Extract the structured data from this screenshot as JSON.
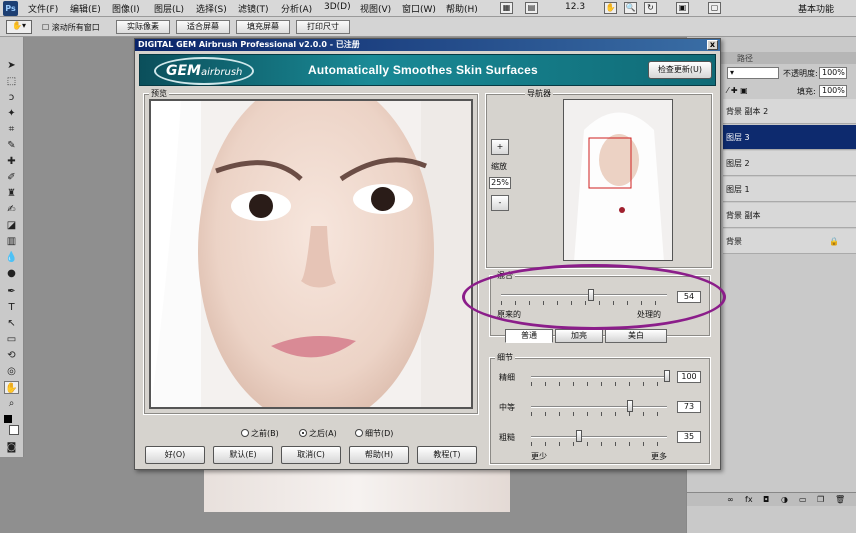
{
  "menubar": {
    "app_icon": "Ps",
    "items": [
      "文件(F)",
      "编辑(E)",
      "图像(I)",
      "图层(L)",
      "选择(S)",
      "滤镜(T)",
      "分析(A)",
      "3D(D)",
      "视图(V)",
      "窗口(W)",
      "帮助(H)"
    ],
    "zoom": "12.3",
    "workspace": "基本功能"
  },
  "optionsbar": {
    "checkbox_label": "滚动所有窗口",
    "buttons": [
      "实际像素",
      "适合屏幕",
      "填充屏幕",
      "打印尺寸"
    ]
  },
  "layers_panel": {
    "opacity_label": "不透明度:",
    "opacity_value": "100%",
    "fill_label": "填充:",
    "fill_value": "100%",
    "layers": [
      "背景 副本 2",
      "图层 3",
      "图层 2",
      "图层 1",
      "背景 副本",
      "背景"
    ],
    "selected_index": 1
  },
  "dialog": {
    "title": "DIGITAL GEM Airbrush Professional v2.0.0 - 已注册",
    "close_label": "x",
    "logo_main": "GEM",
    "logo_sub": "airbrush",
    "tagline": "Automatically Smoothes Skin Surfaces",
    "update_button": "检查更新(U)",
    "preview_label": "预览",
    "navigator_label": "导航器",
    "zoom_in": "+",
    "zoom_label": "缩放",
    "zoom_value": "25%",
    "zoom_out": "-",
    "blend": {
      "label": "混合",
      "value": "54",
      "left_label": "原来的",
      "right_label": "处理的",
      "level": 0.54
    },
    "tabs": [
      "普通",
      "加亮",
      "美白"
    ],
    "detail": {
      "label": "细节",
      "rows": [
        {
          "label": "精细",
          "value": "100",
          "level": 1.0
        },
        {
          "label": "中等",
          "value": "73",
          "level": 0.73
        },
        {
          "label": "粗糙",
          "value": "35",
          "level": 0.35
        }
      ],
      "less": "更少",
      "more": "更多"
    },
    "radios": [
      "之前(B)",
      "之后(A)",
      "细节(D)"
    ],
    "selected_radio": 1,
    "buttons": [
      "好(O)",
      "默认(E)",
      "取消(C)",
      "帮助(H)",
      "教程(T)"
    ]
  }
}
